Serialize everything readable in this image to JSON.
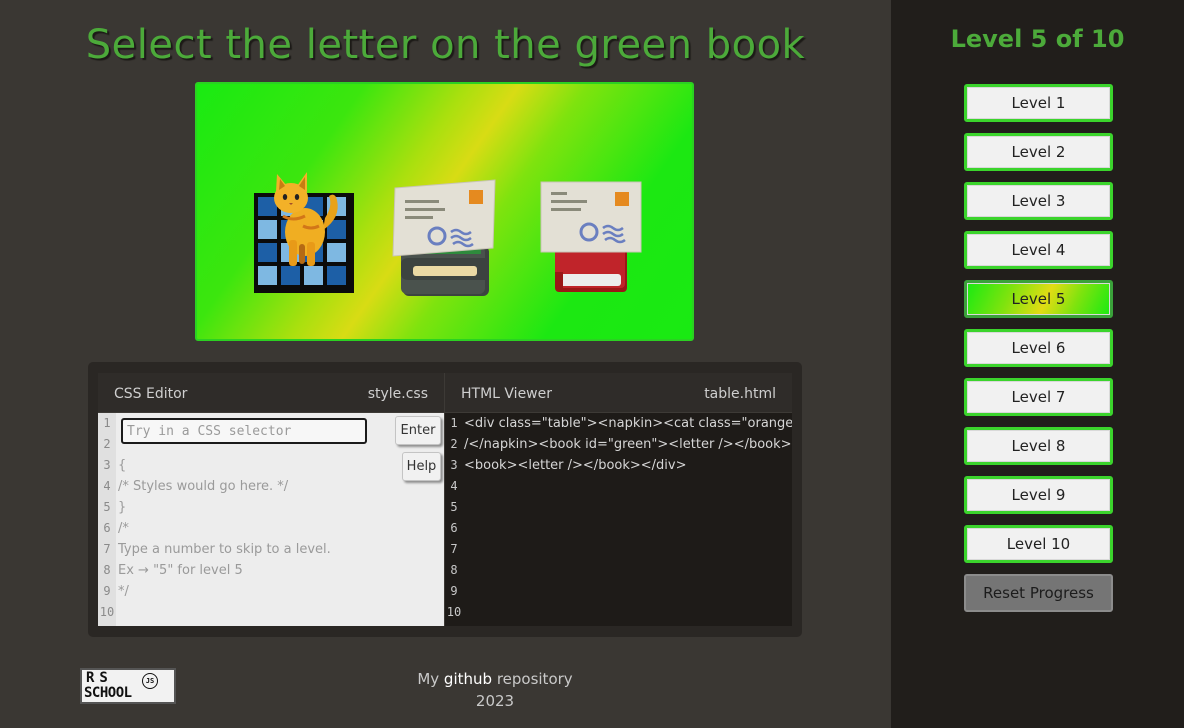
{
  "title": "Select the letter on the green book",
  "sidebar": {
    "level_title": "Level 5 of 10",
    "levels": [
      "Level 1",
      "Level 2",
      "Level 3",
      "Level 4",
      "Level 5",
      "Level 6",
      "Level 7",
      "Level 8",
      "Level 9",
      "Level 10"
    ],
    "active_level": 5,
    "reset_label": "Reset Progress"
  },
  "css_editor": {
    "title": "CSS Editor",
    "file": "style.css",
    "input_placeholder": "Try in a CSS selector",
    "enter_label": "Enter",
    "help_label": "Help",
    "line_numbers": [
      "1",
      "2",
      "3",
      "4",
      "5",
      "6",
      "7",
      "8",
      "9",
      "10"
    ],
    "lines": [
      "{",
      "/* Styles would go here. */",
      "}",
      "/*",
      "Type a number to skip to a level.",
      "Ex → \"5\" for level 5",
      "*/"
    ]
  },
  "html_viewer": {
    "title": "HTML Viewer",
    "file": "table.html",
    "line_numbers": [
      "1",
      "2",
      "3",
      "4",
      "5",
      "6",
      "7",
      "8",
      "9",
      "10"
    ],
    "lines": [
      "<div class=\"table\"><napkin><cat class=\"orange\"",
      "/</napkin><book id=\"green\"><letter /></book>",
      "<book><letter /></book></div>"
    ]
  },
  "footer": {
    "prefix": "My",
    "link": "github",
    "suffix": "repository",
    "year": "2023",
    "logo_line1": "RS",
    "logo_line2": "SCHOOL",
    "logo_badge": "JS"
  },
  "colors": {
    "accent_green": "#4caa3a",
    "stage_border": "#2bd122",
    "background": "#3a3733",
    "sidebar_bg": "#211e1b"
  }
}
